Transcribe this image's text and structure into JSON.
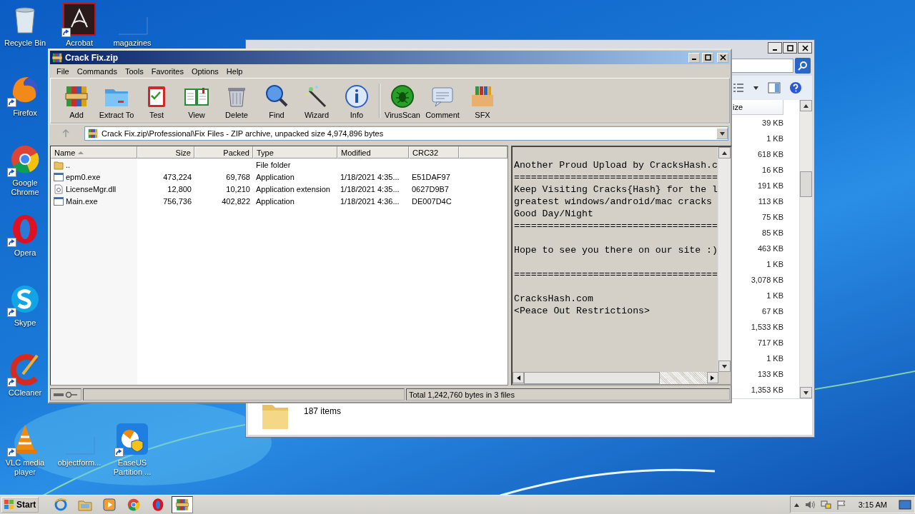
{
  "desktop_icons": [
    {
      "label": "Recycle Bin",
      "kind": "recyclebin",
      "shortcut": false
    },
    {
      "label": "Acrobat",
      "kind": "acrobat",
      "shortcut": true
    },
    {
      "label": "magazines",
      "kind": "blank",
      "shortcut": false
    },
    {
      "label": "Firefox",
      "kind": "firefox",
      "shortcut": true
    },
    {
      "label": "Google Chrome",
      "kind": "chrome",
      "shortcut": true
    },
    {
      "label": "Opera",
      "kind": "opera",
      "shortcut": true
    },
    {
      "label": "Skype",
      "kind": "skype",
      "shortcut": true
    },
    {
      "label": "CCleaner",
      "kind": "ccleaner",
      "shortcut": true
    },
    {
      "label": "VLC media player",
      "kind": "vlc",
      "shortcut": true
    },
    {
      "label": "objectform...",
      "kind": "blank",
      "shortcut": false
    },
    {
      "label": "EaseUS Partition ...",
      "kind": "easeus",
      "shortcut": true
    }
  ],
  "explorer": {
    "size_header": "ize",
    "sizes": [
      "39 KB",
      "1 KB",
      "618 KB",
      "16 KB",
      "191 KB",
      "113 KB",
      "75 KB",
      "85 KB",
      "463 KB",
      "1 KB",
      "3,078 KB",
      "1 KB",
      "67 KB",
      "1,533 KB",
      "717 KB",
      "1 KB",
      "133 KB",
      "1,353 KB"
    ],
    "item_count": "187 items"
  },
  "winrar": {
    "title": "Crack Fix.zip",
    "menu": [
      "File",
      "Commands",
      "Tools",
      "Favorites",
      "Options",
      "Help"
    ],
    "toolbar_groups": [
      [
        {
          "label": "Add",
          "kind": "add"
        },
        {
          "label": "Extract To",
          "kind": "extract"
        },
        {
          "label": "Test",
          "kind": "test"
        },
        {
          "label": "View",
          "kind": "view"
        },
        {
          "label": "Delete",
          "kind": "delete"
        },
        {
          "label": "Find",
          "kind": "find"
        },
        {
          "label": "Wizard",
          "kind": "wizard"
        },
        {
          "label": "Info",
          "kind": "info"
        }
      ],
      [
        {
          "label": "VirusScan",
          "kind": "virusscan"
        },
        {
          "label": "Comment",
          "kind": "comment"
        },
        {
          "label": "SFX",
          "kind": "sfx"
        }
      ]
    ],
    "path": "Crack Fix.zip\\Professional\\Fix Files - ZIP archive, unpacked size 4,974,896 bytes",
    "columns": [
      "Name",
      "Size",
      "Packed",
      "Type",
      "Modified",
      "CRC32"
    ],
    "files": [
      {
        "name": "..",
        "type": "File folder",
        "kind": "folder"
      },
      {
        "name": "epm0.exe",
        "size": "473,224",
        "packed": "69,768",
        "type": "Application",
        "modified": "1/18/2021 4:35...",
        "crc32": "E51DAF97",
        "kind": "exe"
      },
      {
        "name": "LicenseMgr.dll",
        "size": "12,800",
        "packed": "10,210",
        "type": "Application extension",
        "modified": "1/18/2021 4:35...",
        "crc32": "0627D9B7",
        "kind": "dll"
      },
      {
        "name": "Main.exe",
        "size": "756,736",
        "packed": "402,822",
        "type": "Application",
        "modified": "1/18/2021 4:36...",
        "crc32": "DE007D4C",
        "kind": "exe"
      }
    ],
    "comment_blocks": [
      [
        "Another Proud Upload by CracksHash.c",
        "====================================",
        "Keep Visiting Cracks{Hash} for the l",
        "greatest windows/android/mac cracks",
        "Good Day/Night",
        "===================================="
      ],
      [
        "Hope to see you there on our site :)"
      ],
      [
        "===================================="
      ],
      [
        "CracksHash.com",
        "<Peace Out Restrictions>"
      ]
    ],
    "status": "Total 1,242,760 bytes in 3 files"
  },
  "taskbar": {
    "start": "Start",
    "items": [
      {
        "kind": "ie",
        "selected": false
      },
      {
        "kind": "explorer",
        "selected": false
      },
      {
        "kind": "media",
        "selected": false
      },
      {
        "kind": "chrome",
        "selected": false
      },
      {
        "kind": "opera",
        "selected": false
      },
      {
        "kind": "winrar",
        "selected": true
      }
    ],
    "clock": "3:15 AM"
  }
}
